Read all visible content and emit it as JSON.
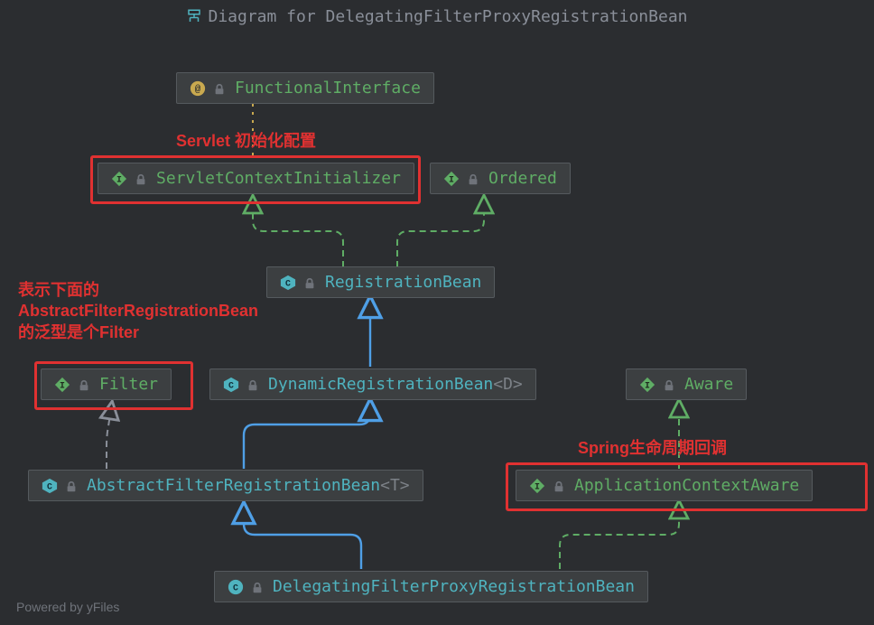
{
  "title": "Diagram for DelegatingFilterProxyRegistrationBean",
  "footer": "Powered by yFiles",
  "nodes": {
    "functionalInterface": {
      "kind": "annotation",
      "label": "FunctionalInterface"
    },
    "servletContextInitializer": {
      "kind": "interface",
      "label": "ServletContextInitializer"
    },
    "ordered": {
      "kind": "interface",
      "label": "Ordered"
    },
    "registrationBean": {
      "kind": "class",
      "label": "RegistrationBean"
    },
    "filter": {
      "kind": "interface",
      "label": "Filter"
    },
    "dynamicRegistrationBean": {
      "kind": "class",
      "label": "DynamicRegistrationBean",
      "generic": "<D>"
    },
    "aware": {
      "kind": "interface",
      "label": "Aware"
    },
    "abstractFilterRegistrationBean": {
      "kind": "class",
      "label": "AbstractFilterRegistrationBean",
      "generic": "<T>"
    },
    "applicationContextAware": {
      "kind": "interface",
      "label": "ApplicationContextAware"
    },
    "delegatingFilterProxyRegistrationBean": {
      "kind": "class",
      "label": "DelegatingFilterProxyRegistrationBean"
    }
  },
  "annotations": {
    "servletInit": "Servlet 初始化配置",
    "filterGeneric": "表示下面的\nAbstractFilterRegistrationBean\n的泛型是个Filter",
    "springLifecycle": "Spring生命周期回调"
  }
}
